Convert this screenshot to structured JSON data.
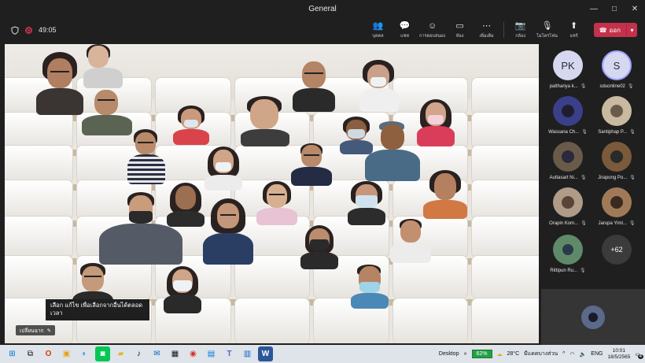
{
  "window": {
    "title": "General",
    "controls": {
      "minimize": "—",
      "maximize": "□",
      "close": "✕"
    }
  },
  "toolbar": {
    "timer": "49:05",
    "buttons": [
      {
        "id": "people",
        "label": "บุคคล",
        "icon": "people-icon",
        "glyph": "👥"
      },
      {
        "id": "chat",
        "label": "แชท",
        "icon": "chat-icon",
        "glyph": "💬"
      },
      {
        "id": "reactions",
        "label": "การตอบสนอง",
        "icon": "reactions-icon",
        "glyph": "☺"
      },
      {
        "id": "rooms",
        "label": "ห้อง",
        "icon": "rooms-icon",
        "glyph": "▭"
      },
      {
        "id": "more",
        "label": "เพิ่มเติม",
        "icon": "more-icon",
        "glyph": "⋯"
      },
      {
        "id": "camera",
        "label": "กล้อง",
        "icon": "camera-icon",
        "glyph": "📷"
      },
      {
        "id": "mic",
        "label": "ไมโครโฟน",
        "icon": "mic-off-icon",
        "glyph": "🎙"
      },
      {
        "id": "share",
        "label": "แชร์",
        "icon": "share-icon",
        "glyph": "⬆"
      }
    ],
    "leave_label": "ออก",
    "leave_color": "#c4314b"
  },
  "stage": {
    "caption": "เลือก แก้ไข เพื่อเลือกจากอื่นได้ตลอด\nเวลา",
    "name_tag": "เปลี่ยนฉาก"
  },
  "panel": {
    "participants": [
      {
        "name": "patthariya k...",
        "initials": "PK",
        "type": "initials"
      },
      {
        "name": "sduonline02",
        "initials": "S",
        "type": "initials-active"
      },
      {
        "name": "Wassana Ch...",
        "initials": "",
        "type": "photo",
        "tone": "#3a3f8a"
      },
      {
        "name": "Santiphap P...",
        "initials": "",
        "type": "photo",
        "tone": "#c9b9a0"
      },
      {
        "name": "Auttasart Ni...",
        "initials": "",
        "type": "photo",
        "tone": "#6a5a4a"
      },
      {
        "name": "Jirapong Po...",
        "initials": "",
        "type": "photo",
        "tone": "#7a5a3a"
      },
      {
        "name": "Orapin Kom...",
        "initials": "",
        "type": "photo",
        "tone": "#b09a88"
      },
      {
        "name": "Jarupa Yiml...",
        "initials": "",
        "type": "photo",
        "tone": "#a07a58"
      },
      {
        "name": "Rittipun Ru...",
        "initials": "",
        "type": "photo",
        "tone": "#5f8a6a"
      },
      {
        "name": "",
        "initials": "+62",
        "type": "more"
      }
    ]
  },
  "taskbar": {
    "desktop_label": "Desktop",
    "battery": "62%",
    "weather": "28°C",
    "weather_text": "มีแดดบางส่วน",
    "lang": "ENG",
    "time": "10:01",
    "date": "18/5/2565",
    "notifications": "4"
  }
}
